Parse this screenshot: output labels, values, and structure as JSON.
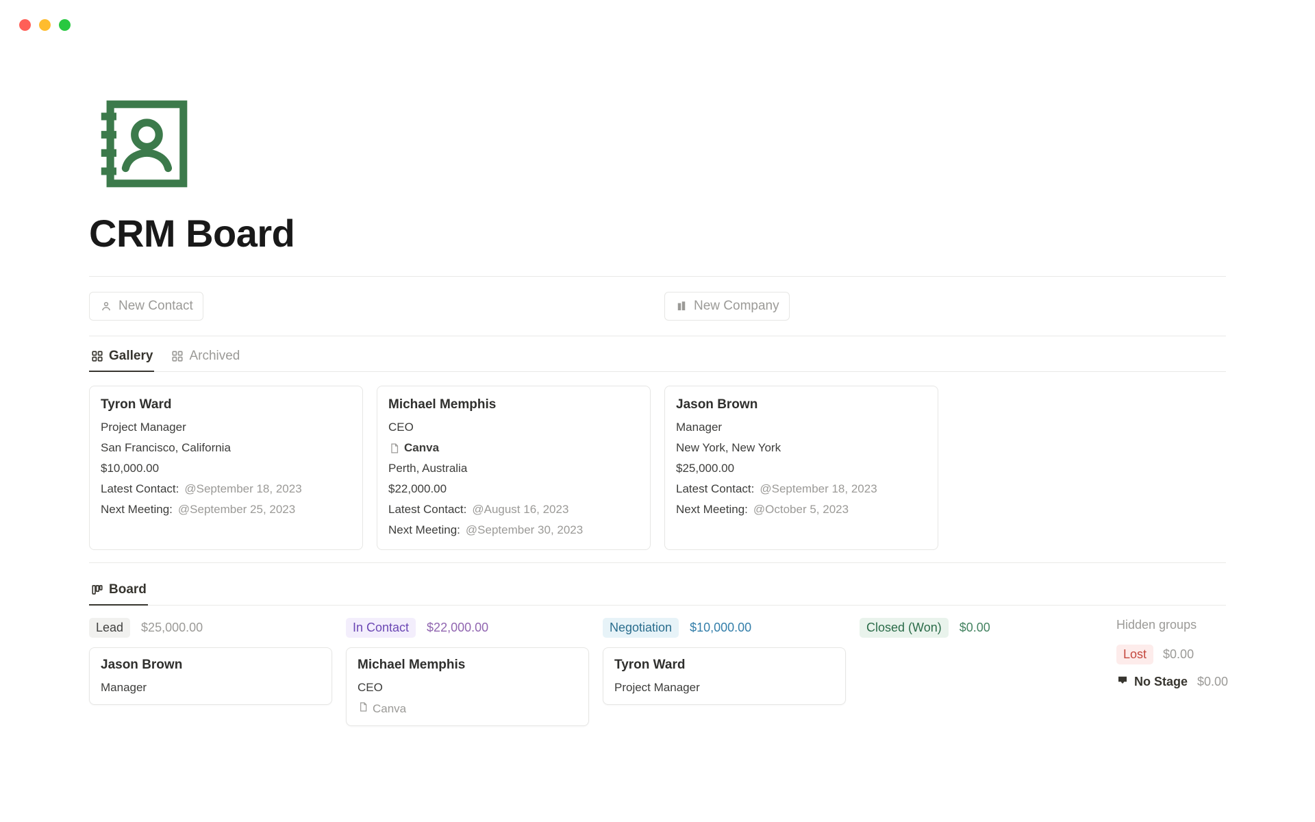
{
  "page": {
    "title": "CRM Board"
  },
  "actions": {
    "new_contact": {
      "label": "New Contact"
    },
    "new_company": {
      "label": "New Company"
    }
  },
  "gallery_tabs": {
    "gallery": "Gallery",
    "archived": "Archived"
  },
  "gallery_cards": [
    {
      "name": "Tyron Ward",
      "role": "Project Manager",
      "company": "",
      "location": "San Francisco, California",
      "amount": "$10,000.00",
      "latest_contact_label": "Latest Contact:",
      "latest_contact_value": "@September 18, 2023",
      "next_meeting_label": "Next Meeting:",
      "next_meeting_value": "@September 25, 2023"
    },
    {
      "name": "Michael Memphis",
      "role": "CEO",
      "company": "Canva",
      "location": "Perth, Australia",
      "amount": "$22,000.00",
      "latest_contact_label": "Latest Contact:",
      "latest_contact_value": "@August 16, 2023",
      "next_meeting_label": "Next Meeting:",
      "next_meeting_value": "@September 30, 2023"
    },
    {
      "name": "Jason Brown",
      "role": "Manager",
      "company": "",
      "location": "New York, New York",
      "amount": "$25,000.00",
      "latest_contact_label": "Latest Contact:",
      "latest_contact_value": "@September 18, 2023",
      "next_meeting_label": "Next Meeting:",
      "next_meeting_value": "@October 5, 2023"
    }
  ],
  "board_tab": {
    "label": "Board"
  },
  "board": {
    "columns": [
      {
        "stage": "Lead",
        "amount": "$25,000.00",
        "chip_class": "chip-lead",
        "amount_class": "",
        "card": {
          "name": "Jason Brown",
          "role": "Manager",
          "company": ""
        }
      },
      {
        "stage": "In Contact",
        "amount": "$22,000.00",
        "chip_class": "chip-incontact",
        "amount_class": "purple",
        "card": {
          "name": "Michael Memphis",
          "role": "CEO",
          "company": "Canva"
        }
      },
      {
        "stage": "Negotiation",
        "amount": "$10,000.00",
        "chip_class": "chip-neg",
        "amount_class": "blue",
        "card": {
          "name": "Tyron Ward",
          "role": "Project Manager",
          "company": ""
        }
      },
      {
        "stage": "Closed (Won)",
        "amount": "$0.00",
        "chip_class": "chip-won",
        "amount_class": "green",
        "card": null
      }
    ],
    "hidden": {
      "label": "Hidden groups",
      "rows": [
        {
          "chip": "Lost",
          "chip_class": "chip-lost",
          "amount": "$0.00"
        },
        {
          "label": "No Stage",
          "amount": "$0.00"
        }
      ]
    }
  }
}
